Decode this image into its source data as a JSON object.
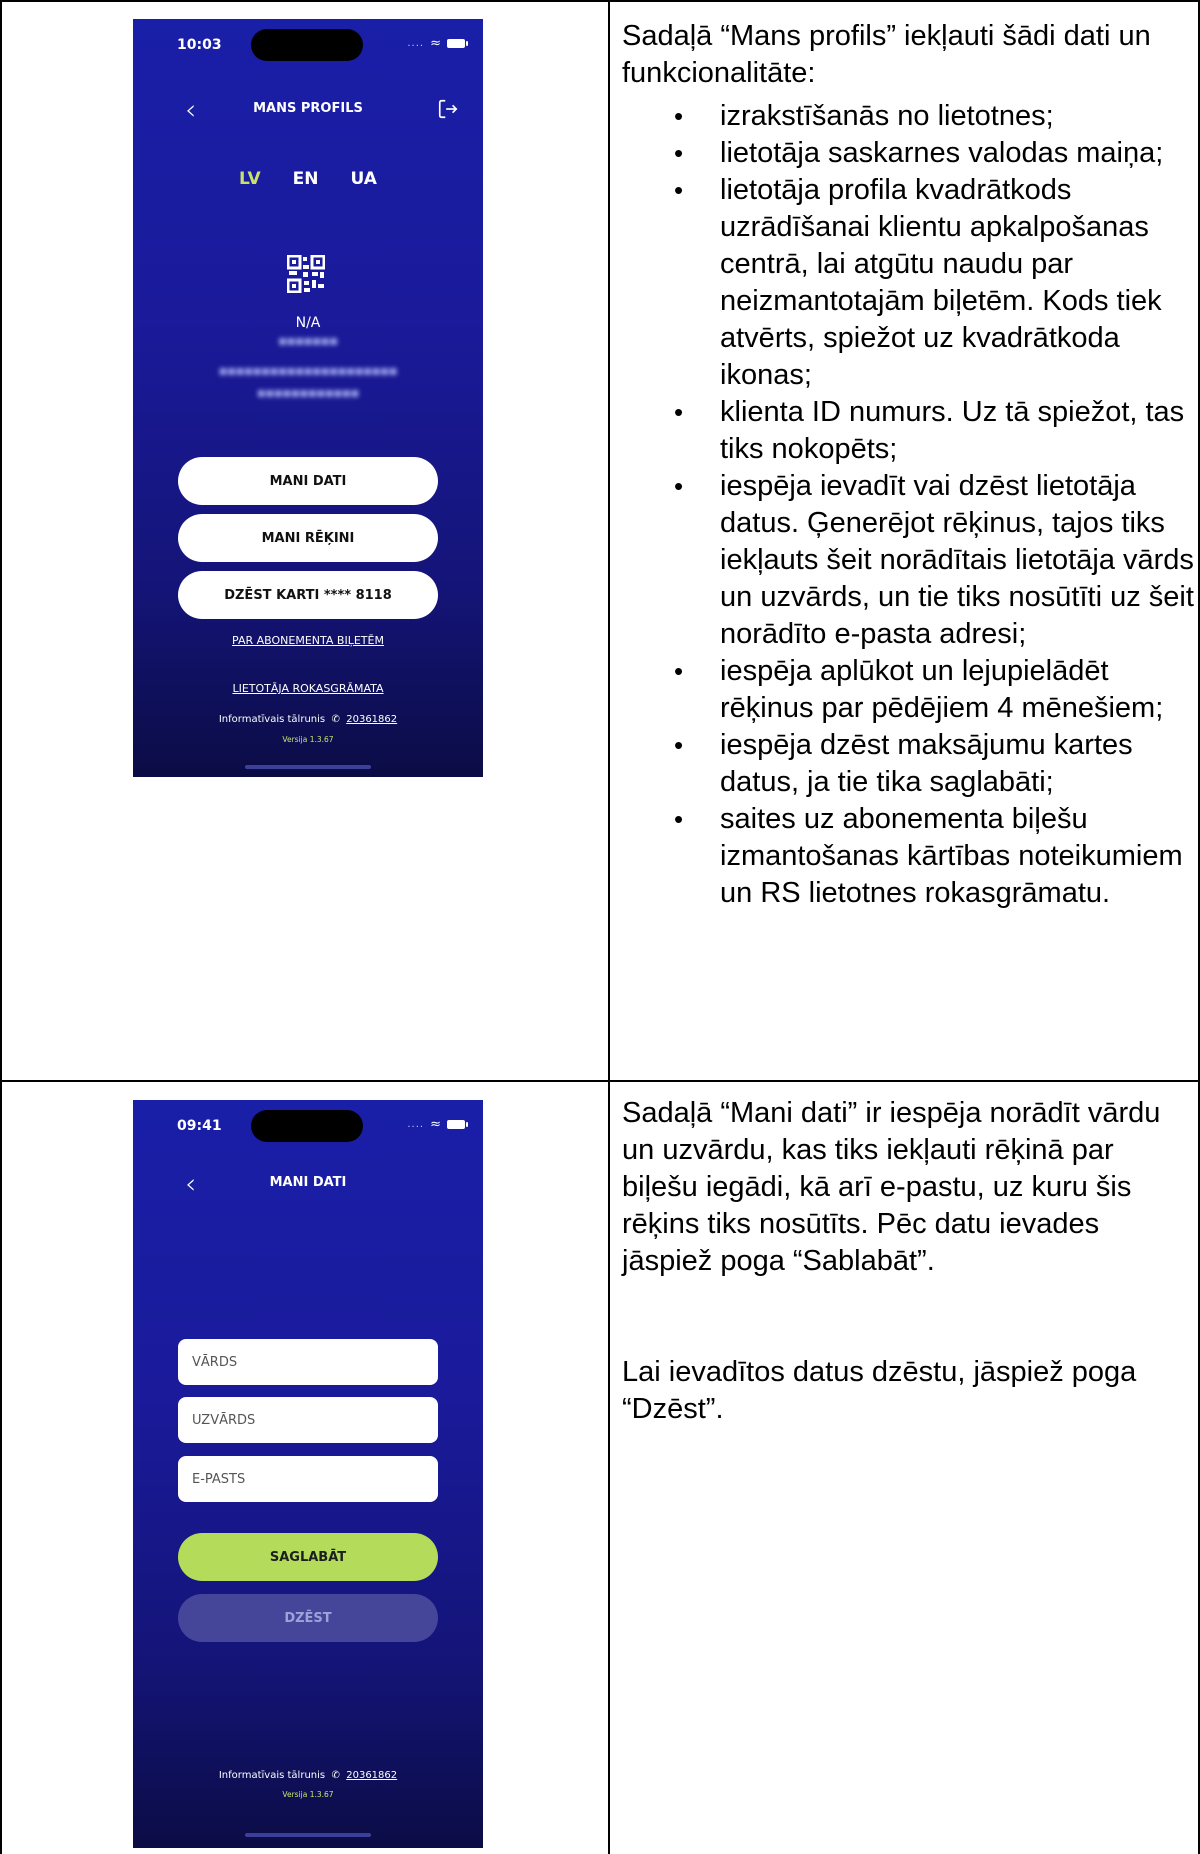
{
  "row1": {
    "phone": {
      "status_time": "10:03",
      "signal_text": "....",
      "title": "MANS PROFILS",
      "languages": [
        "LV",
        "EN",
        "UA"
      ],
      "active_language": "LV",
      "na_text": "N/A",
      "buttons": [
        "MANI DATI",
        "MANI RĒĶINI",
        "DZĒST KARTI **** 8118"
      ],
      "link_abonement": "PAR ABONEMENTA BIĻETĒM",
      "link_manual": "LIETOTĀJA ROKASGRĀMATA",
      "info_phone_label": "Informatīvais tālrunis",
      "info_phone_number": "20361862",
      "version": "Versija 1.3.67"
    },
    "text": {
      "intro": "Sadaļā “Mans profils” iekļauti šādi dati un funkcionalitāte:",
      "bullets": [
        "izrakstīšanās no lietotnes;",
        "lietotāja saskarnes valodas maiņa;",
        "lietotāja profila kvadrātkods uzrādīšanai klientu apkalpošanas centrā, lai atgūtu naudu par neizmantotajām biļetēm. Kods tiek atvērts, spiežot uz kvadrātkoda ikonas;",
        "klienta ID numurs. Uz tā spiežot, tas tiks nokopēts;",
        "iespēja ievadīt vai dzēst lietotāja datus. Ģenerējot rēķinus, tajos tiks iekļauts šeit norādītais lietotāja vārds un uzvārds, un tie tiks nosūtīti uz šeit norādīto e-pasta adresi;",
        "iespēja aplūkot un lejupielādēt rēķinus par pēdējiem 4 mēnešiem;",
        "iespēja dzēst maksājumu kartes datus, ja tie tika saglabāti;",
        "saites uz abonementa biļešu izmantošanas kārtības noteikumiem un RS lietotnes rokasgrāmatu."
      ]
    }
  },
  "row2": {
    "phone": {
      "status_time": "09:41",
      "signal_text": "....",
      "title": "MANI DATI",
      "fields": [
        "VĀRDS",
        "UZVĀRDS",
        "E-PASTS"
      ],
      "save_label": "SAGLABĀT",
      "delete_label": "DZĒST",
      "info_phone_label": "Informatīvais tālrunis",
      "info_phone_number": "20361862",
      "version": "Versija 1.3.67"
    },
    "text": {
      "para1": "Sadaļā “Mani dati” ir iespēja norādīt vārdu un uzvārdu, kas tiks iekļauti rēķinā par biļešu iegādi, kā arī e-pastu, uz kuru šis rēķins tiks nosūtīts. Pēc datu ievades jāspiež poga “Sablabāt”.",
      "para2": "Lai ievadītos datus dzēstu, jāspiež poga “Dzēst”."
    }
  },
  "colors": {
    "accent_green": "#b4dc5a",
    "phone_bg_top": "#1a1fa8",
    "phone_bg_bottom": "#0b0c45"
  }
}
